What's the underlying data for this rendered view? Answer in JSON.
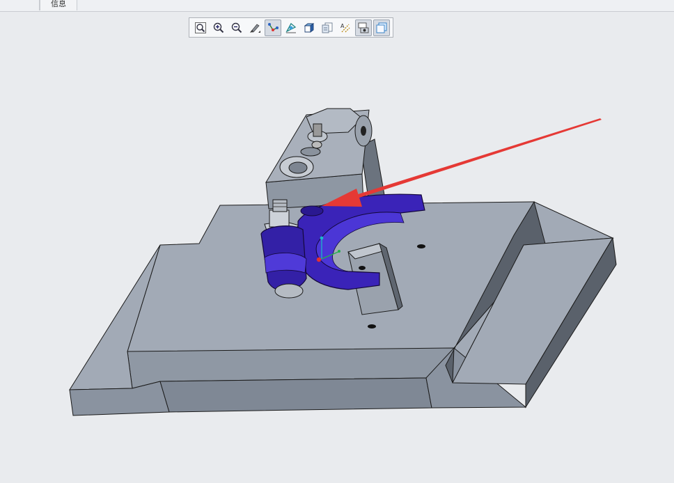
{
  "tabs": [
    {
      "label": ""
    },
    {
      "label": "信息"
    }
  ],
  "toolbar": {
    "buttons": [
      {
        "icon": "zoom-refit-icon",
        "active": false
      },
      {
        "icon": "zoom-in-icon",
        "active": false
      },
      {
        "icon": "zoom-out-icon",
        "active": false
      },
      {
        "icon": "repaint-icon",
        "active": false
      },
      {
        "icon": "datum-axis-display-icon",
        "active": true
      },
      {
        "icon": "datum-point-display-icon",
        "active": false
      },
      {
        "icon": "display-style-icon",
        "active": false
      },
      {
        "icon": "saved-orientations-icon",
        "active": false
      },
      {
        "icon": "spin-center-icon",
        "active": false
      },
      {
        "icon": "view-manager-icon",
        "active": true
      },
      {
        "icon": "annotation-display-icon",
        "active": true
      }
    ]
  },
  "model": {
    "selected_part": "shift-fork",
    "colors": {
      "background": "#e9ebee",
      "body_light": "#a2aab6",
      "body_mid": "#8a93a0",
      "body_dark": "#5a616b",
      "selected_part": "#3a23b8",
      "arrow": "#e53935"
    }
  }
}
